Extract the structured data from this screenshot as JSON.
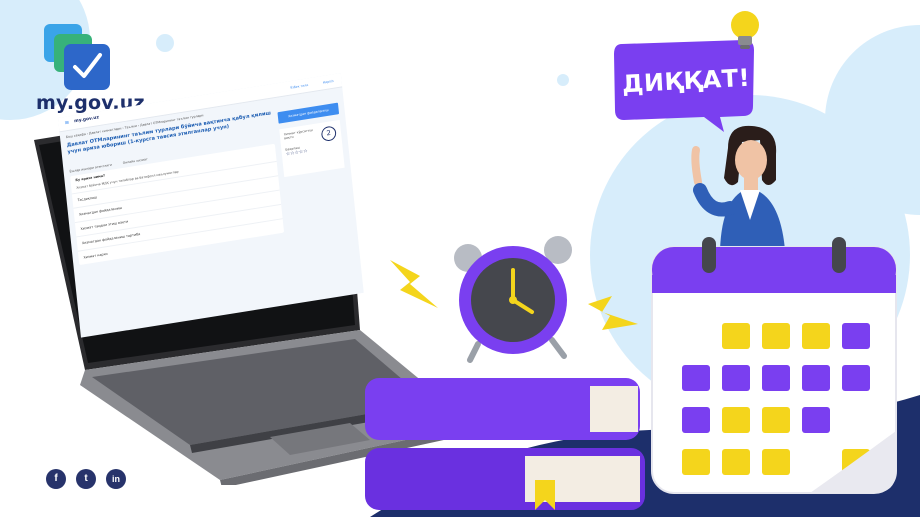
{
  "brand": {
    "name": "my.gov.uz"
  },
  "attention": {
    "label": "ДИҚҚАТ!"
  },
  "laptop_screen": {
    "logo_text": "my.gov.uz",
    "top_links": [
      "Ўзбек тили",
      "Кирish"
    ],
    "breadcrumb": "Бош саҳифа › Давлат хизматлари › Таълим › Давлат ОТМларининг таълим турлари",
    "page_title": "Давлат ОТМларининг таълим турлари бўйича вақтинча қабул қилиш учун ариза юбориш (1-курсга тавсия этилганлар учун)",
    "tags": [
      "Ёшлар ишлари агентлиги",
      "Онлайн хизмат"
    ],
    "sections": [
      "Бу ариза нима?",
      "Тасдиқлаш",
      "Хизматдан фойдаланиш",
      "Хизмат тақдим этиш вақти",
      "Хизматдан фойдаланиш тартиби",
      "Хизмат нархи"
    ],
    "intro_text": "Хизмат бўйича МДҲ учун талаблар ва батафсил маълумотлар",
    "side_button": "Хизматдан фойдаланиш",
    "side_info_label": "Хизмат кўрсатиш вақти",
    "side_info_value": "2",
    "rating_label": "Баҳолаш",
    "rating_stars": "☆☆☆☆☆"
  },
  "social": {
    "facebook": "f",
    "twitter": "t",
    "linkedin": "in"
  },
  "colors": {
    "purple": "#7a3ff0",
    "yellow": "#f4d51c",
    "navy": "#1d2f6b",
    "sky": "#d7edfb",
    "blue": "#3e8df0"
  }
}
